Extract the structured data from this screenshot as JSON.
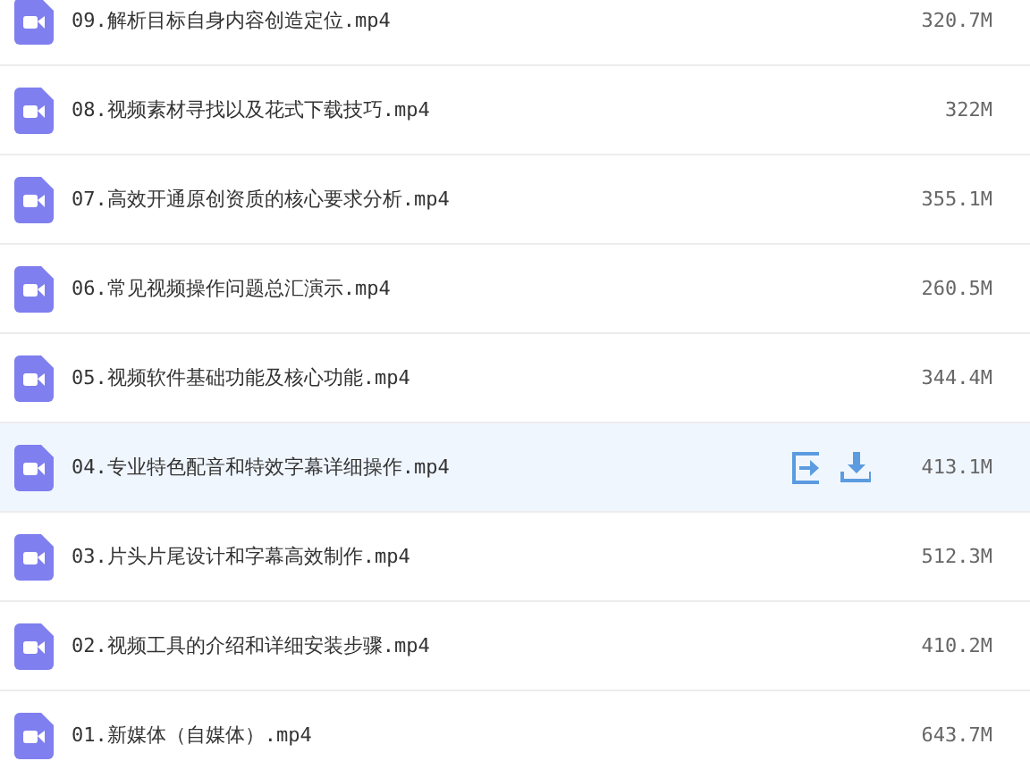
{
  "files": [
    {
      "name": "09.解析目标自身内容创造定位.mp4",
      "size": "320.7M",
      "highlighted": false
    },
    {
      "name": "08.视频素材寻找以及花式下载技巧.mp4",
      "size": "322M",
      "highlighted": false
    },
    {
      "name": "07.高效开通原创资质的核心要求分析.mp4",
      "size": "355.1M",
      "highlighted": false
    },
    {
      "name": "06.常见视频操作问题总汇演示.mp4",
      "size": "260.5M",
      "highlighted": false
    },
    {
      "name": "05.视频软件基础功能及核心功能.mp4",
      "size": "344.4M",
      "highlighted": false
    },
    {
      "name": "04.专业特色配音和特效字幕详细操作.mp4",
      "size": "413.1M",
      "highlighted": true
    },
    {
      "name": "03.片头片尾设计和字幕高效制作.mp4",
      "size": "512.3M",
      "highlighted": false
    },
    {
      "name": "02.视频工具的介绍和详细安装步骤.mp4",
      "size": "410.2M",
      "highlighted": false
    },
    {
      "name": "01.新媒体（自媒体）.mp4",
      "size": "643.7M",
      "highlighted": false
    }
  ]
}
